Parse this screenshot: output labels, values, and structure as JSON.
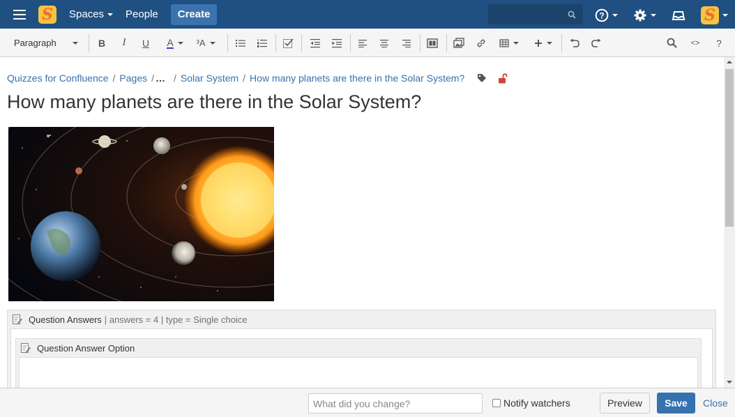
{
  "topnav": {
    "logo": "S",
    "spaces_label": "Spaces",
    "people_label": "People",
    "create_label": "Create",
    "icons": [
      "menu-icon",
      "help-icon",
      "settings-icon",
      "notifications-icon",
      "user-avatar"
    ]
  },
  "toolbar": {
    "paragraph_label": "Paragraph",
    "bold": "B",
    "italic": "I",
    "underline": "U",
    "text_color": "A",
    "text_format": "³A",
    "code": "<>",
    "help": "?",
    "icons": [
      "bullet-list-icon",
      "numbered-list-icon",
      "task-list-icon",
      "outdent-icon",
      "indent-icon",
      "align-left-icon",
      "align-center-icon",
      "align-right-icon",
      "page-layout-icon",
      "insert-image-icon",
      "link-icon",
      "table-icon",
      "insert-more-icon",
      "undo-icon",
      "redo-icon",
      "find-icon"
    ]
  },
  "breadcrumb": {
    "items": [
      "Quizzes for Confluence",
      "Pages",
      "…",
      "Solar System",
      "How many planets are there in the Solar System?"
    ],
    "separator": "/"
  },
  "page": {
    "title": "How many planets are there in the Solar System?"
  },
  "macro": {
    "name": "Question Answers",
    "params": "| answers = 4 | type = Single choice",
    "inner_name": "Question Answer Option"
  },
  "footer": {
    "change_placeholder": "What did you change?",
    "notify_label": "Notify watchers",
    "notify_checked": false,
    "preview_label": "Preview",
    "save_label": "Save",
    "close_label": "Close"
  },
  "colors": {
    "header": "#205081",
    "accent": "#3572b0",
    "create_button": "#3b73af",
    "restriction_icon": "#d04437"
  }
}
